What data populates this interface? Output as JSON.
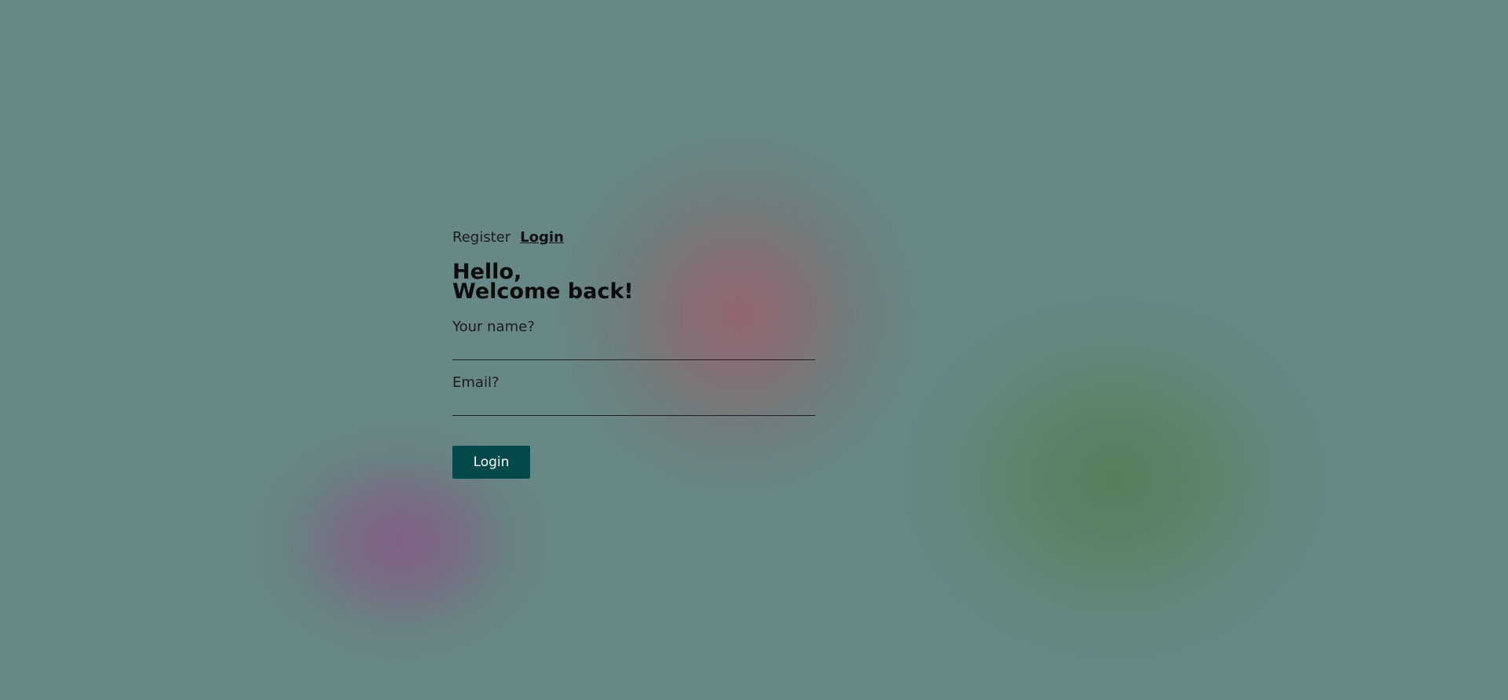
{
  "tabs": {
    "register_label": "Register",
    "login_label": "Login"
  },
  "heading": {
    "line1": "Hello,",
    "line2": "Welcome back!"
  },
  "form": {
    "name_label": "Your name?",
    "name_value": "",
    "email_label": "Email?",
    "email_value": "",
    "submit_label": "Login"
  },
  "colors": {
    "background": "#678886",
    "button": "#044a4a",
    "blob_red": "#8c6a70",
    "blob_purple": "#7d6484",
    "blob_green": "#547e5a"
  }
}
